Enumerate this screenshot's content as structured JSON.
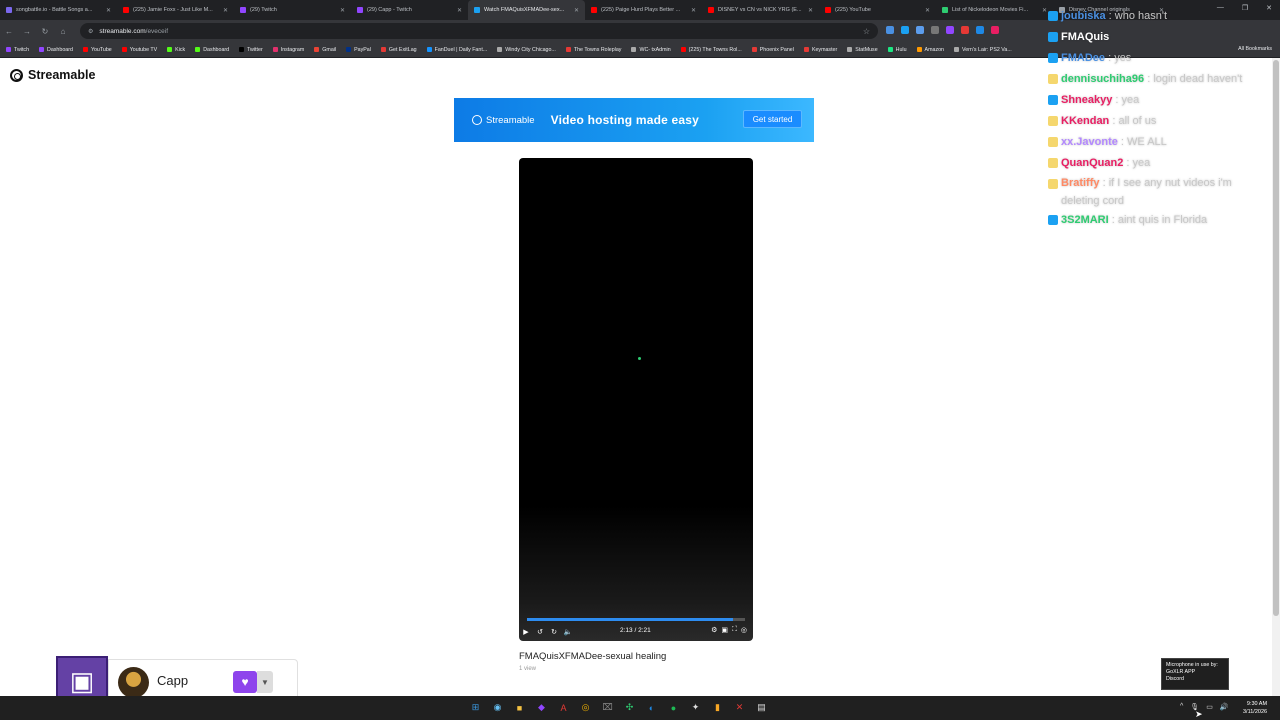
{
  "browser": {
    "tabs": [
      {
        "title": "songbattle.io - Battle Songs a...",
        "color": "#7b68ee",
        "active": false
      },
      {
        "title": "(225) Jamie Foxx - Just Like M...",
        "color": "#ff0000",
        "active": false
      },
      {
        "title": "(29) Twitch",
        "color": "#9146ff",
        "active": false
      },
      {
        "title": "(29) Capp - Twitch",
        "color": "#9146ff",
        "active": false
      },
      {
        "title": "Watch FMAQuisXFMADee-sex...",
        "color": "#1ba1f2",
        "active": true
      },
      {
        "title": "(225) Paige Hurd Plays Better ...",
        "color": "#ff0000",
        "active": false
      },
      {
        "title": "DISNEY vs CN vs NICK YRG (E...",
        "color": "#ff0000",
        "active": false
      },
      {
        "title": "(225) YouTube",
        "color": "#ff0000",
        "active": false
      },
      {
        "title": "List of Nickelodeon Movies Fi...",
        "color": "#2ecc71",
        "active": false
      },
      {
        "title": "Disney Channel originals",
        "color": "#9aa0a6",
        "active": false
      }
    ],
    "url": {
      "host": "streamable.com",
      "path": "/eveceif"
    },
    "bookmarks": [
      "Twitch",
      "Dashboard",
      "YouTube",
      "Youtube TV",
      "Kick",
      "Dashboard",
      "Twitter",
      "Instagram",
      "Gmail",
      "PayPal",
      "Get ExitLag",
      "FanDuel | Daily Fant...",
      "Windy City Chicago...",
      "The Towns Roleplay",
      "WC- txAdmin",
      "(225) The Towns Rol...",
      "Phoenix Panel",
      "Keymaster",
      "StatMuse",
      "Hulu",
      "Amazon",
      "Vern's Lair: PS2 Va..."
    ],
    "all_bookmarks": "All Bookmarks"
  },
  "page": {
    "logo": "Streamable",
    "banner": {
      "brand": "Streamable",
      "tagline": "Video hosting made easy",
      "cta": "Get started"
    },
    "video": {
      "time": "2:13 / 2:21",
      "progress": 0.943,
      "title": "FMAQuisXFMADee-sexual healing",
      "views": "1 view"
    }
  },
  "chat": {
    "messages": [
      {
        "user": "joubiska",
        "text": "who hasn't",
        "color": "#4a90e2"
      },
      {
        "user": "FMAQuis",
        "text": "",
        "color": "#ffffff"
      },
      {
        "user": "FMADee",
        "text": "yes",
        "color": "#4a90e2"
      },
      {
        "user": "dennisuchiha96",
        "text": "login dead haven't",
        "color": "#2ecc71"
      },
      {
        "user": "Shneakyy",
        "text": "yea",
        "color": "#e91e63"
      },
      {
        "user": "KKendan",
        "text": "all of us",
        "color": "#e91e63"
      },
      {
        "user": "xx.Javonte",
        "text": "WE ALL",
        "color": "#b388ff"
      },
      {
        "user": "QuanQuan2",
        "text": "yea",
        "color": "#e91e63"
      },
      {
        "user": "Bratiffy",
        "text": "if I see any nut videos i'm deleting cord",
        "color": "#ff8a65"
      },
      {
        "user": "3S2MARI",
        "text": "aint quis in Florida",
        "color": "#2ecc71"
      }
    ]
  },
  "widget": {
    "streamer": "Capp"
  },
  "system": {
    "mic_tooltip": [
      "Microphone in use by:",
      "GoXLR APP",
      "Discord"
    ],
    "time": "9:30 AM",
    "date": "3/11/2026"
  }
}
